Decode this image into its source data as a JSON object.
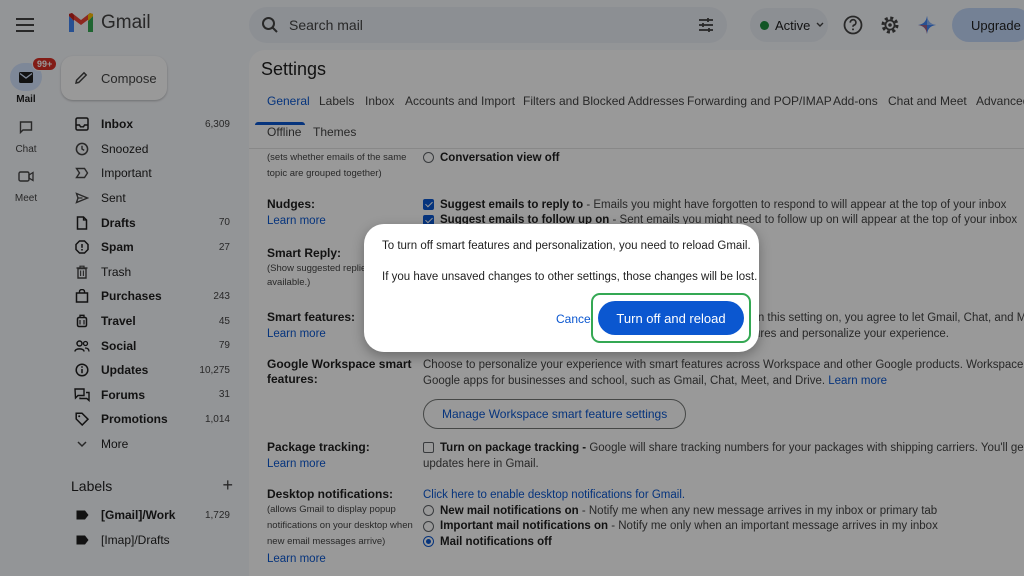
{
  "app": {
    "name": "Gmail"
  },
  "header": {
    "search_placeholder": "Search mail",
    "status_label": "Active",
    "upgrade_label": "Upgrade"
  },
  "rail": {
    "mail_label": "Mail",
    "mail_badge": "99+",
    "chat_label": "Chat",
    "meet_label": "Meet"
  },
  "sidebar": {
    "compose_label": "Compose",
    "items": [
      {
        "label": "Inbox",
        "count": "6,309",
        "icon": "inbox-icon",
        "bold": true
      },
      {
        "label": "Snoozed",
        "count": "",
        "icon": "clock-icon",
        "bold": false
      },
      {
        "label": "Important",
        "count": "",
        "icon": "important-icon",
        "bold": false
      },
      {
        "label": "Sent",
        "count": "",
        "icon": "send-icon",
        "bold": false
      },
      {
        "label": "Drafts",
        "count": "70",
        "icon": "draft-icon",
        "bold": true
      },
      {
        "label": "Spam",
        "count": "27",
        "icon": "spam-icon",
        "bold": true
      },
      {
        "label": "Trash",
        "count": "",
        "icon": "trash-icon",
        "bold": false
      },
      {
        "label": "Purchases",
        "count": "243",
        "icon": "purchases-icon",
        "bold": true
      },
      {
        "label": "Travel",
        "count": "45",
        "icon": "travel-icon",
        "bold": true
      },
      {
        "label": "Social",
        "count": "79",
        "icon": "social-icon",
        "bold": true
      },
      {
        "label": "Updates",
        "count": "10,275",
        "icon": "updates-icon",
        "bold": true
      },
      {
        "label": "Forums",
        "count": "31",
        "icon": "forums-icon",
        "bold": true
      },
      {
        "label": "Promotions",
        "count": "1,014",
        "icon": "promotions-icon",
        "bold": true
      },
      {
        "label": "More",
        "count": "",
        "icon": "chevron-down-icon",
        "bold": false
      }
    ],
    "labels_heading": "Labels",
    "labels": [
      {
        "label": "[Gmail]/Work",
        "count": "1,729",
        "bold": true
      },
      {
        "label": "[Imap]/Drafts",
        "count": "",
        "bold": false
      }
    ]
  },
  "settings": {
    "title": "Settings",
    "tabs_row1": [
      "General",
      "Labels",
      "Inbox",
      "Accounts and Import",
      "Filters and Blocked Addresses",
      "Forwarding and POP/IMAP",
      "Add-ons",
      "Chat and Meet",
      "Advanced"
    ],
    "tabs_row2": [
      "Offline",
      "Themes"
    ],
    "conversation": {
      "sub1": "(sets whether emails of the same",
      "sub2": "topic are grouped together)",
      "option": "Conversation view off"
    },
    "nudges": {
      "label": "Nudges:",
      "learn": "Learn more",
      "opt1_bold": "Suggest emails to reply to",
      "opt1_text": " - Emails you might have forgotten to respond to will appear at the top of your inbox",
      "opt2_bold": "Suggest emails to follow up on",
      "opt2_text": " - Sent emails you might need to follow up on will appear at the top of your inbox"
    },
    "smart_reply": {
      "label": "Smart Reply:",
      "sub1": "(Show suggested replies when",
      "sub2": "available.)"
    },
    "smart_features": {
      "label": "Smart features:",
      "learn": "Learn more",
      "line1": "rn this setting on, you agree to let Gmail, Chat, and Meet",
      "line2": "ures and personalize your experience."
    },
    "workspace": {
      "label": "Google Workspace smart features:",
      "line1": "Choose to personalize your experience with smart features across Workspace and other Google products. Workspace inclu",
      "line2": "Google apps for businesses and school, such as Gmail, Chat, Meet, and Drive. ",
      "learn": "Learn more",
      "button": "Manage Workspace smart feature settings"
    },
    "package": {
      "label": "Package tracking:",
      "learn": "Learn more",
      "bold": "Turn on package tracking - ",
      "text": "Google will share tracking numbers for your packages with shipping carriers. You'll get statu",
      "line2": "updates here in Gmail."
    },
    "desktop": {
      "label": "Desktop notifications:",
      "sub1": "(allows Gmail to display popup",
      "sub2": "notifications on your desktop when",
      "sub3": "new email messages arrive)",
      "learn": "Learn more",
      "enable_link": "Click here to enable desktop notifications for Gmail.",
      "opt1_bold": "New mail notifications on",
      "opt1_text": " - Notify me when any new message arrives in my inbox or primary tab",
      "opt2_bold": "Important mail notifications on",
      "opt2_text": " - Notify me only when an important message arrives in my inbox",
      "opt3_bold": "Mail notifications off"
    }
  },
  "dialog": {
    "line1": "To turn off smart features and personalization, you need to reload Gmail.",
    "line2": "If you have unsaved changes to other settings, those changes will be lost.",
    "cancel_label": "Cancel",
    "confirm_label": "Turn off and reload"
  },
  "colors": {
    "accent": "#0b57d0",
    "highlight": "#34a853",
    "badge": "#d93025"
  }
}
